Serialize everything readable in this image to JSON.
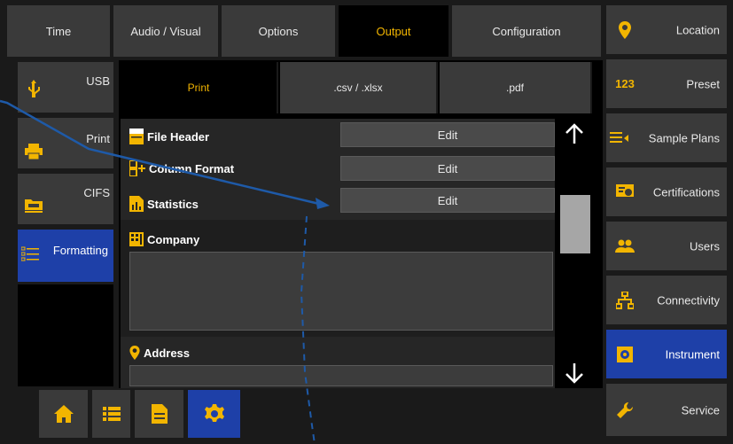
{
  "top_tabs": [
    {
      "label": "Time"
    },
    {
      "label": "Audio / Visual"
    },
    {
      "label": "Options"
    },
    {
      "label": "Output"
    },
    {
      "label": "Configuration"
    }
  ],
  "right_sidebar": [
    {
      "label": "Location",
      "icon": "location-pin-icon"
    },
    {
      "label": "Preset",
      "icon": "number-123-icon",
      "icon_text": "123"
    },
    {
      "label": "Sample Plans",
      "icon": "list-arrow-icon"
    },
    {
      "label": "Certifications",
      "icon": "certificate-icon"
    },
    {
      "label": "Users",
      "icon": "users-icon"
    },
    {
      "label": "Connectivity",
      "icon": "network-icon"
    },
    {
      "label": "Instrument",
      "icon": "instrument-icon"
    },
    {
      "label": "Service",
      "icon": "wrench-icon"
    }
  ],
  "left_tabs": [
    {
      "label": "USB",
      "icon": "usb-icon"
    },
    {
      "label": "Print",
      "icon": "printer-icon"
    },
    {
      "label": "CIFS",
      "icon": "network-folder-icon"
    },
    {
      "label": "Formatting",
      "icon": "formatting-list-icon"
    }
  ],
  "inner_tabs": [
    {
      "label": "Print"
    },
    {
      "label": ".csv / .xlsx"
    },
    {
      "label": ".pdf"
    }
  ],
  "rows": [
    {
      "label": "File Header",
      "button": "Edit"
    },
    {
      "label": "Column Format",
      "button": "Edit"
    },
    {
      "label": "Statistics",
      "button": "Edit"
    }
  ],
  "company": {
    "label": "Company",
    "value": ""
  },
  "address": {
    "label": "Address",
    "value": ""
  },
  "scroll": {
    "position": 0.3
  },
  "colors": {
    "accent": "#f2b500",
    "active": "#1e40a8",
    "panel": "#3a3a3a",
    "annotation": "#1e5aa8"
  }
}
